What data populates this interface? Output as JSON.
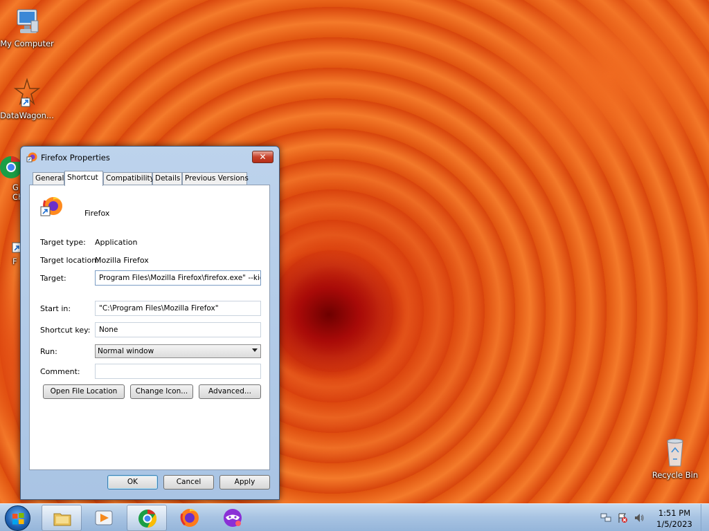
{
  "desktop": {
    "icons": [
      {
        "label": "My Computer"
      },
      {
        "label": "DataWagon..."
      },
      {
        "label": "G\nCh"
      },
      {
        "label": "F"
      },
      {
        "label": "Recycle Bin"
      }
    ]
  },
  "window": {
    "title": "Firefox Properties",
    "close_label": "✕",
    "tabs": [
      {
        "label": "General"
      },
      {
        "label": "Shortcut"
      },
      {
        "label": "Compatibility"
      },
      {
        "label": "Details"
      },
      {
        "label": "Previous Versions"
      }
    ],
    "app_name": "Firefox",
    "target_type_label": "Target type:",
    "target_type_value": "Application",
    "target_location_label": "Target location:",
    "target_location_value": "Mozilla Firefox",
    "target_label": "Target:",
    "target_value": "Program Files\\Mozilla Firefox\\firefox.exe\" --kios",
    "start_in_label": "Start in:",
    "start_in_value": "\"C:\\Program Files\\Mozilla Firefox\"",
    "shortcut_key_label": "Shortcut key:",
    "shortcut_key_value": "None",
    "run_label": "Run:",
    "run_value": "Normal window",
    "comment_label": "Comment:",
    "comment_value": "",
    "open_file_location": "Open File Location",
    "change_icon": "Change Icon...",
    "advanced": "Advanced...",
    "ok": "OK",
    "cancel": "Cancel",
    "apply": "Apply"
  },
  "taskbar": {
    "time": "1:51 PM",
    "date": "1/5/2023",
    "items": [
      "file-explorer",
      "media-player",
      "chrome",
      "firefox",
      "private-browser"
    ]
  }
}
